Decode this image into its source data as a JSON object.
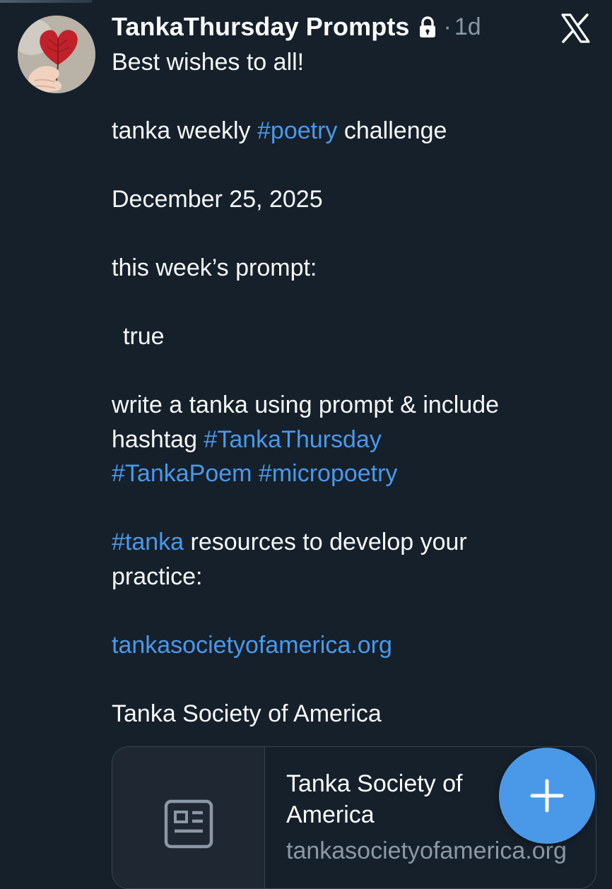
{
  "post": {
    "author": "TankaThursday Prompts",
    "separator": "·",
    "age": "1d",
    "lines": {
      "greeting": "Best wishes to all!",
      "challenge_pre": "tanka weekly ",
      "challenge_tag": "#poetry",
      "challenge_post": " challenge",
      "date": "December 25, 2025",
      "prompt_label": "this week’s prompt:",
      "prompt_word": "true",
      "instruction_line1": "write a tanka using prompt & include",
      "instruction_pre": "hashtag ",
      "tag_tankathursday": "#TankaThursday",
      "tag_tankapoem": "#TankaPoem",
      "tag_space": " ",
      "tag_micropoetry": "#micropoetry",
      "tag_tanka": "#tanka",
      "resources_post": " resources to develop your",
      "resources_line2": "practice:",
      "link": "tankasocietyofamerica.org",
      "org_name": "Tanka Society of America"
    }
  },
  "link_card": {
    "title": "Tanka Society of America",
    "domain": "tankasocietyofamerica.org"
  },
  "icons": {
    "avatar": "avatar-heart-leaf-photo",
    "lock": "lock-icon",
    "brand": "x-logo-icon",
    "card": "article-icon",
    "compose": "plus-icon"
  },
  "colors": {
    "background": "#15202b",
    "text": "#f7f9f9",
    "link": "#4a99e9",
    "muted": "#8b98a5",
    "fab": "#4a99e9"
  }
}
